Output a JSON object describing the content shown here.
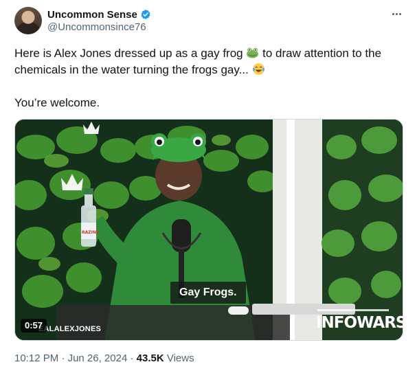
{
  "author": {
    "display_name": "Uncommon Sense",
    "handle": "@Uncommonsince76"
  },
  "tweet": {
    "line1_pre": "Here is Alex Jones dressed up as a gay frog",
    "line1_post": "to draw attention to the",
    "line2": "chemicals in the water turning the frogs gay...",
    "line3": "You’re welcome.",
    "emojis": [
      "frog-emoji",
      "tears-of-joy-emoji"
    ]
  },
  "media": {
    "duration": "0:57",
    "channel_watermark": "EALALEXJONES",
    "caption": "Gay Frogs.",
    "logo": "INFOWARS",
    "bottle_label": "RAZINE"
  },
  "meta": {
    "time": "10:12 PM",
    "separator": "·",
    "date": "Jun 26, 2024",
    "views_count": "43.5K",
    "views_label": "Views"
  },
  "colors": {
    "text": "#0f1419",
    "secondary": "#536471",
    "verified": "#1d9bf0",
    "frog_green": "#3aa745"
  }
}
